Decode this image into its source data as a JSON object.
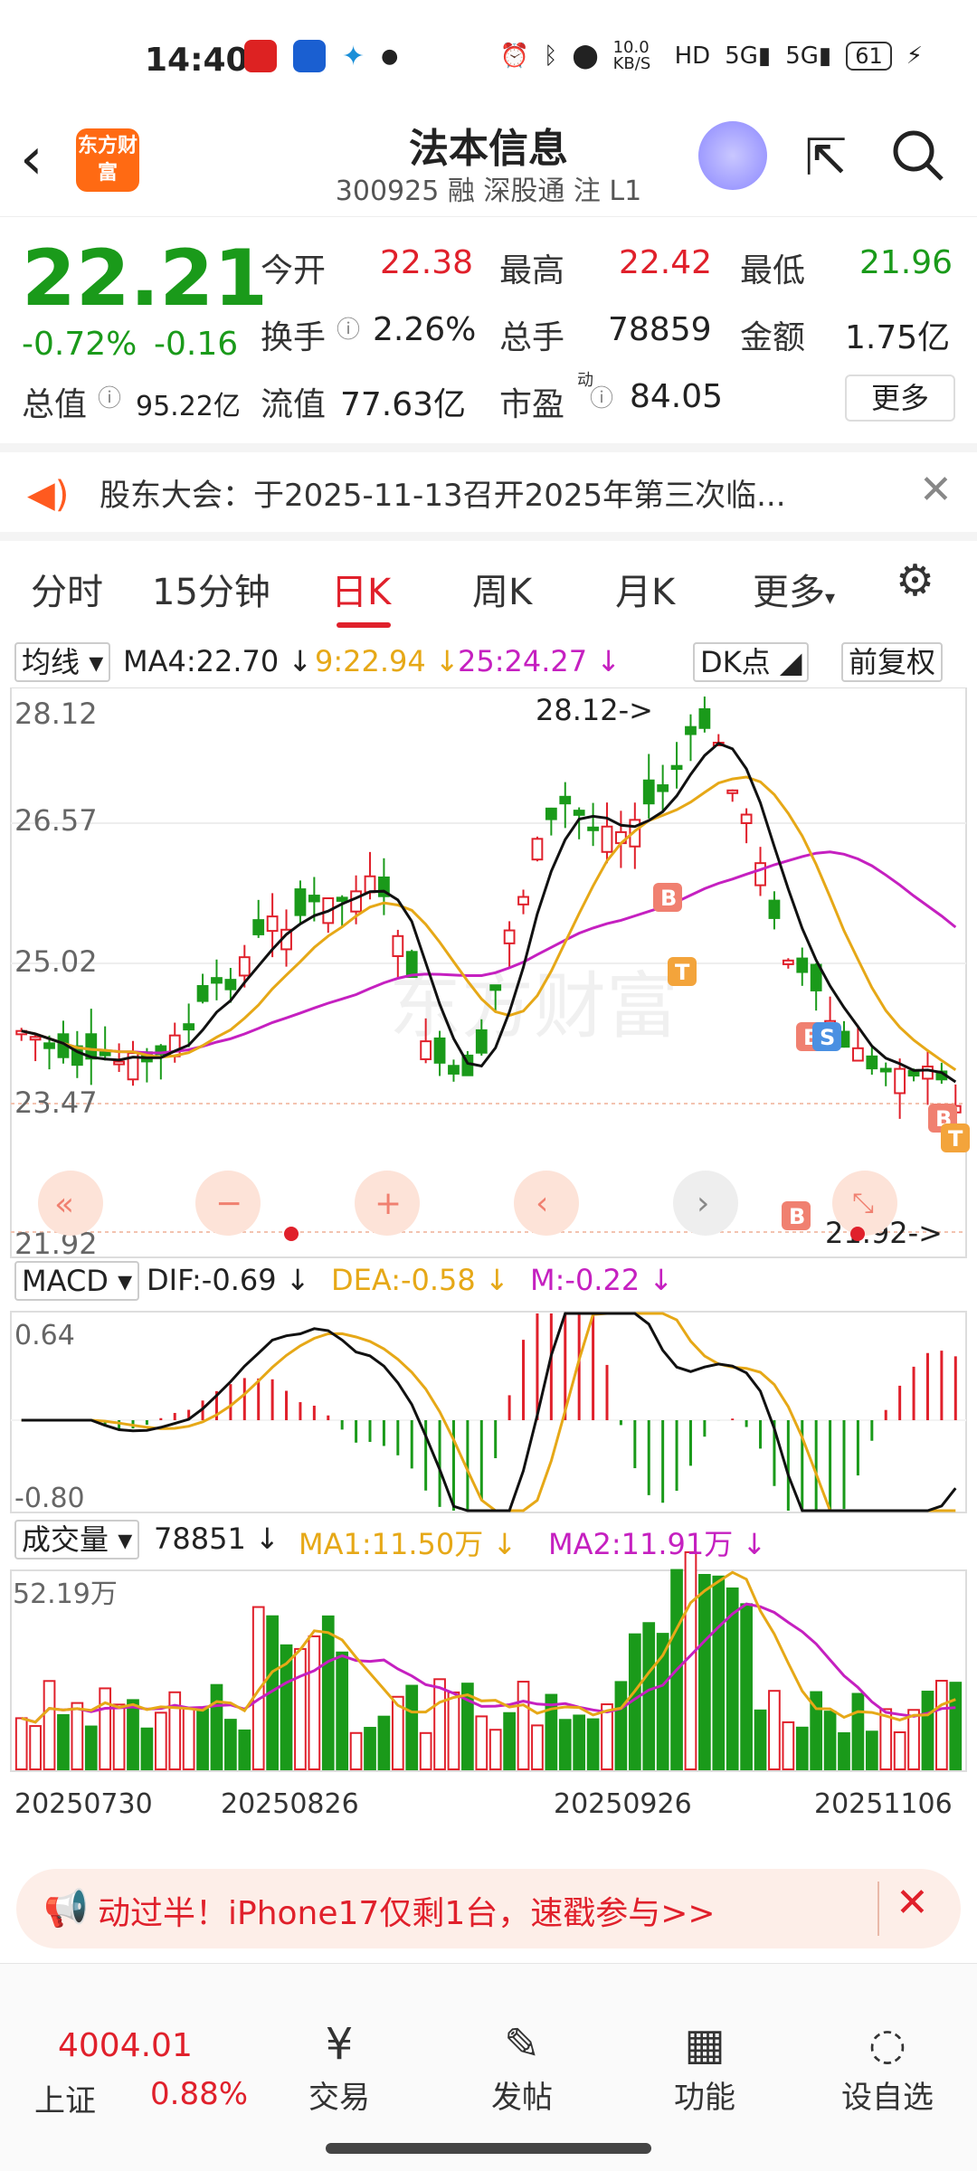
{
  "status": {
    "time": "14:40",
    "net_speed": "10.0 KB/S",
    "battery": "61"
  },
  "header": {
    "logo_text": "东方财富",
    "stock_name": "法本信息",
    "stock_code_tags": "300925 融 深股通 注 L1"
  },
  "quote": {
    "price": "22.21",
    "change_pct": "-0.72%",
    "change_abs": "-0.16",
    "open_label": "今开",
    "open": "22.38",
    "high_label": "最高",
    "high": "22.42",
    "low_label": "最低",
    "low": "21.96",
    "turnover_label": "换手",
    "turnover": "2.26%",
    "volume_label": "总手",
    "volume": "78859",
    "amount_label": "金额",
    "amount": "1.75亿",
    "mktcap_label": "总值",
    "mktcap": "95.22亿",
    "float_label": "流值",
    "float": "77.63亿",
    "pe_label": "市盈",
    "pe_sup": "动",
    "pe": "84.05",
    "more_label": "更多"
  },
  "notice": {
    "text": "股东大会：于2025-11-13召开2025年第三次临..."
  },
  "tabs": [
    {
      "label": "分时"
    },
    {
      "label": "15分钟"
    },
    {
      "label": "日K"
    },
    {
      "label": "周K"
    },
    {
      "label": "月K"
    },
    {
      "label": "更多"
    }
  ],
  "kline": {
    "ma_selector": "均线",
    "ma4": "MA4:22.70",
    "ma9": "9:22.94",
    "ma25": "25:24.27",
    "dk_label": "DK点",
    "adjust_label": "前复权",
    "axis": {
      "top": "28.12",
      "l2": "26.57",
      "l3": "25.02",
      "l4": "23.47",
      "bottom": "21.92"
    },
    "max_marker": "28.12->",
    "min_marker": "21.92->"
  },
  "macd": {
    "selector": "MACD",
    "dif": "DIF:-0.69",
    "dea": "DEA:-0.58",
    "m": "M:-0.22",
    "axis_top": "0.64",
    "axis_bottom": "-0.80"
  },
  "volume": {
    "selector": "成交量",
    "value": "78851",
    "ma1": "MA1:11.50万",
    "ma2": "MA2:11.91万",
    "axis_top": "52.19万",
    "dates": [
      "20250730",
      "20250826",
      "20250926",
      "20251106"
    ]
  },
  "promo": {
    "text": "动过半！iPhone17仅剩1台，速戳参与>>"
  },
  "bottom": {
    "index_value": "4004.01",
    "index_name": "上证",
    "index_change": "0.88%",
    "nav": [
      {
        "label": "交易"
      },
      {
        "label": "发帖"
      },
      {
        "label": "功能"
      },
      {
        "label": "设自选"
      }
    ]
  },
  "colors": {
    "up": "#e0202b",
    "down": "#1a9a1a",
    "ma4": "#111111",
    "ma9": "#e6a817",
    "ma25": "#c520c0"
  }
}
